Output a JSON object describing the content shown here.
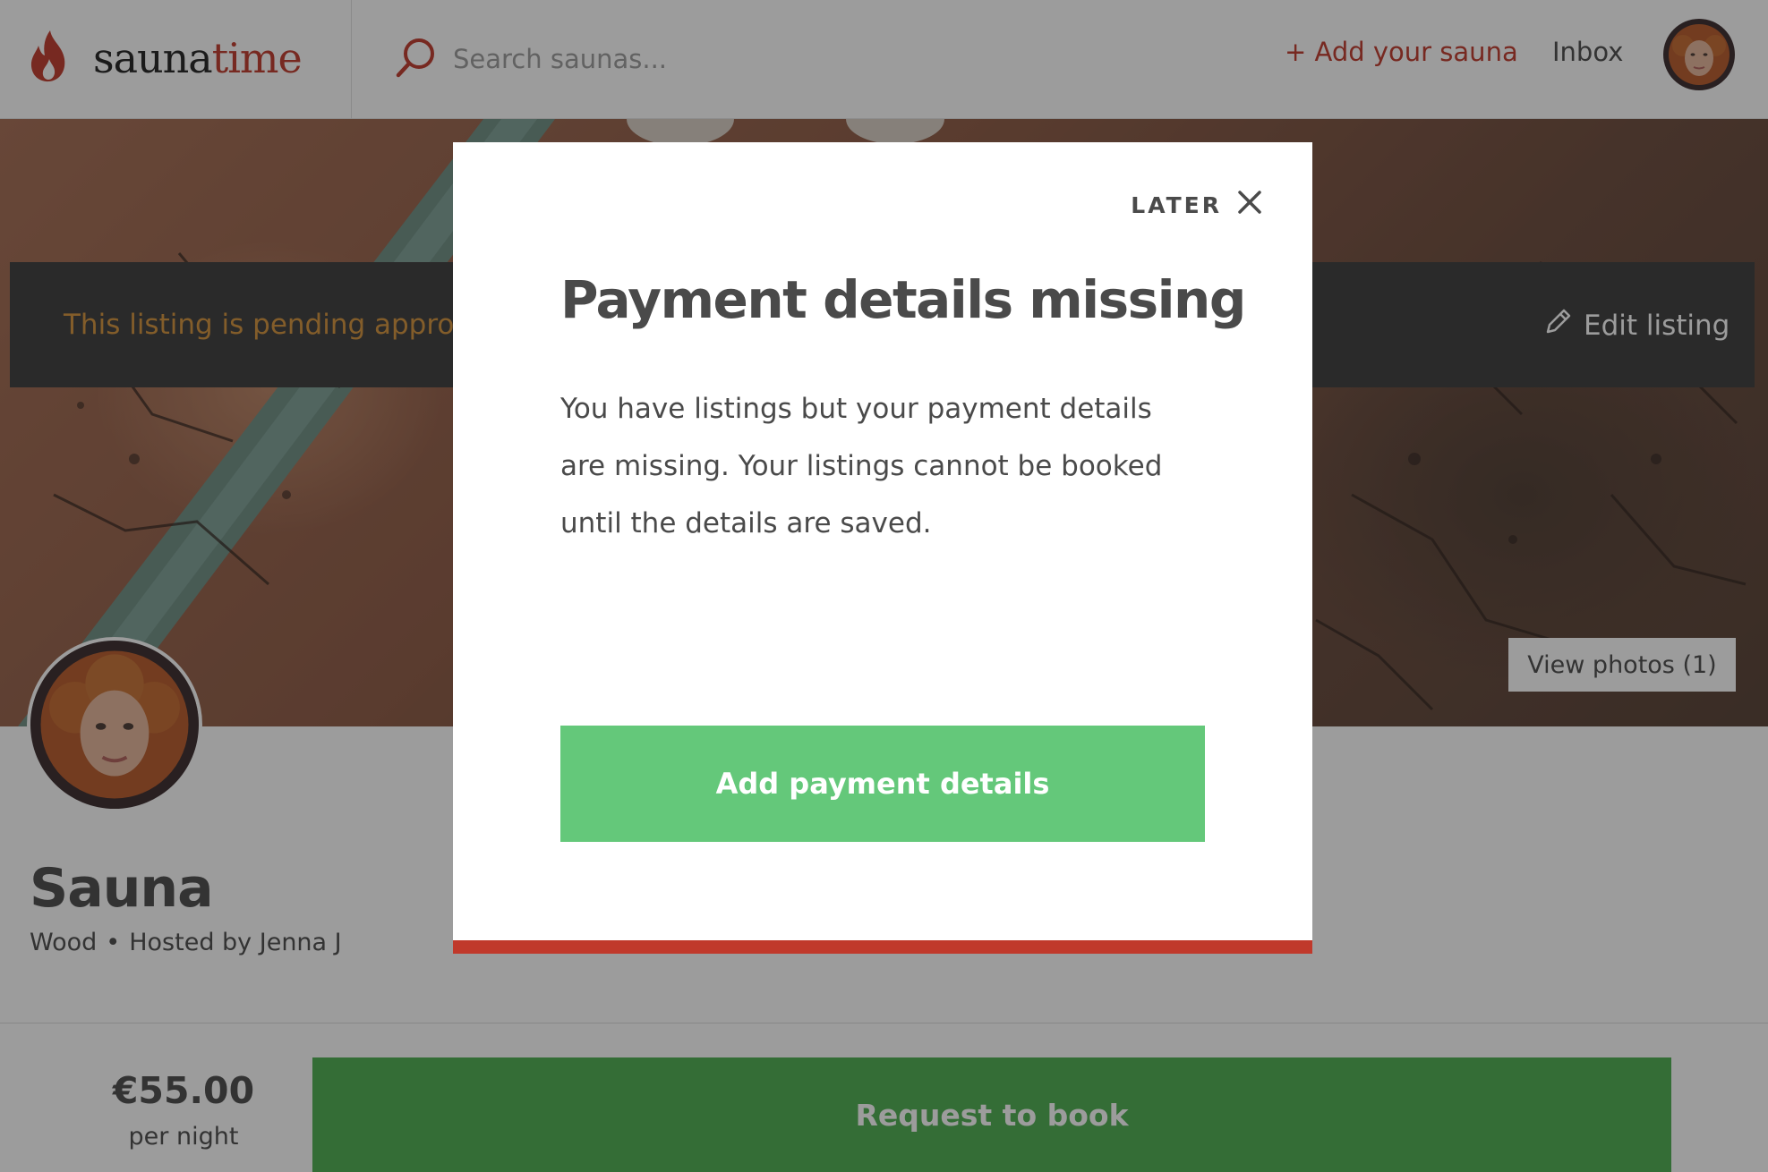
{
  "brand": {
    "name_part1": "sauna",
    "name_part2": "time",
    "accent_color": "#c0392b"
  },
  "header": {
    "search_placeholder": "Search saunas...",
    "add_sauna_label": "+ Add your sauna",
    "inbox_label": "Inbox"
  },
  "hero": {
    "pending_text": "This listing is pending approval",
    "edit_label": "Edit listing",
    "view_photos_label": "View photos (1)"
  },
  "listing": {
    "title": "Sauna",
    "category": "Wood",
    "separator": "•",
    "hosted_by": "Hosted by Jenna J"
  },
  "booking": {
    "price": "€55.00",
    "unit": "per night",
    "button_label": "Request to book"
  },
  "modal": {
    "dismiss_label": "LATER",
    "title": "Payment details missing",
    "body": "You have listings but your payment details are missing. Your listings cannot be booked until the details are saved.",
    "cta_label": "Add payment details",
    "cta_color": "#64c87a",
    "accent_border_color": "#c0392b"
  },
  "icons": {
    "logo": "flame-icon",
    "search": "search-icon",
    "edit": "pencil-icon",
    "close": "close-icon"
  }
}
